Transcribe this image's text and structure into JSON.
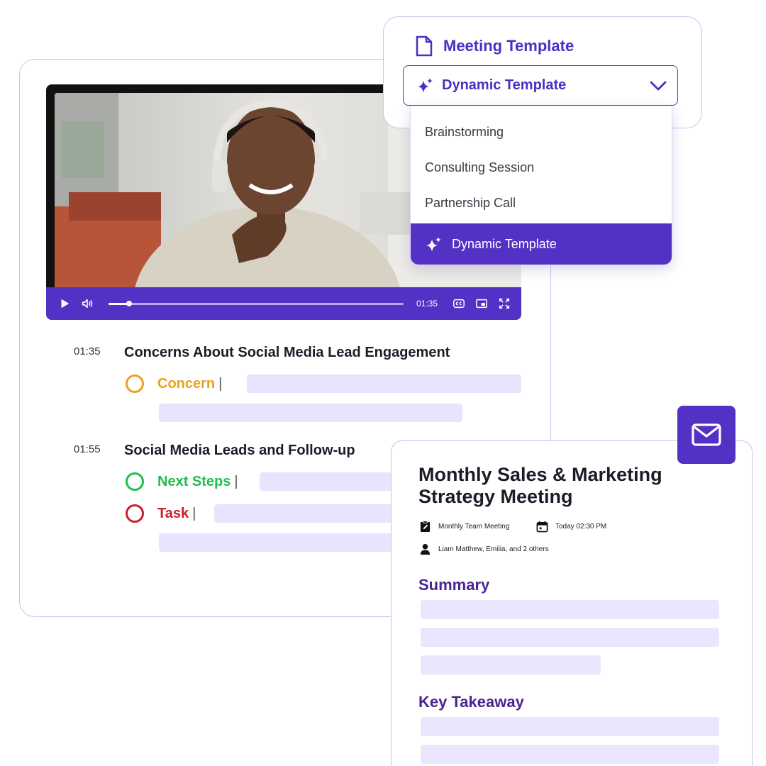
{
  "video": {
    "current_time": "01:35",
    "progress": 0.07
  },
  "transcript": [
    {
      "timestamp": "01:35",
      "topic": "Concerns About Social Media Lead Engagement",
      "tags": [
        {
          "label": "Concern",
          "color": "#e8a21f"
        }
      ]
    },
    {
      "timestamp": "01:55",
      "topic": "Social Media Leads and Follow-up",
      "tags": [
        {
          "label": "Next Steps",
          "color": "#1fbf4f"
        },
        {
          "label": "Task",
          "color": "#c8202a"
        }
      ]
    }
  ],
  "template_picker": {
    "title": "Meeting Template",
    "selected": "Dynamic Template",
    "options": [
      "Brainstorming",
      "Consulting Session",
      "Partnership Call",
      "Dynamic Template"
    ]
  },
  "summary_card": {
    "title": "Monthly Sales & Marketing Strategy Meeting",
    "meeting_type": "Monthly Team Meeting",
    "datetime": "Today 02:30 PM",
    "attendees": "Liam Matthew, Emilia, and 2 others",
    "sections": [
      "Summary",
      "Key Takeaway"
    ]
  },
  "icons": {
    "template": "document-icon",
    "sparkle": "sparkle-icon",
    "chevron": "chevron-down-icon",
    "mail": "mail-icon",
    "play": "play-icon",
    "volume": "volume-icon",
    "captions": "cc-icon",
    "pip": "picture-in-picture-icon",
    "fullscreen": "fullscreen-icon",
    "meeting_type": "clipboard-edit-icon",
    "calendar": "calendar-icon",
    "person": "person-icon"
  },
  "colors": {
    "accent": "#5331c4",
    "accent_text": "#4a2fc4",
    "section_heading": "#4a2590",
    "placeholder_bar": "#e9e4fd",
    "card_border": "#c9c2f0"
  }
}
